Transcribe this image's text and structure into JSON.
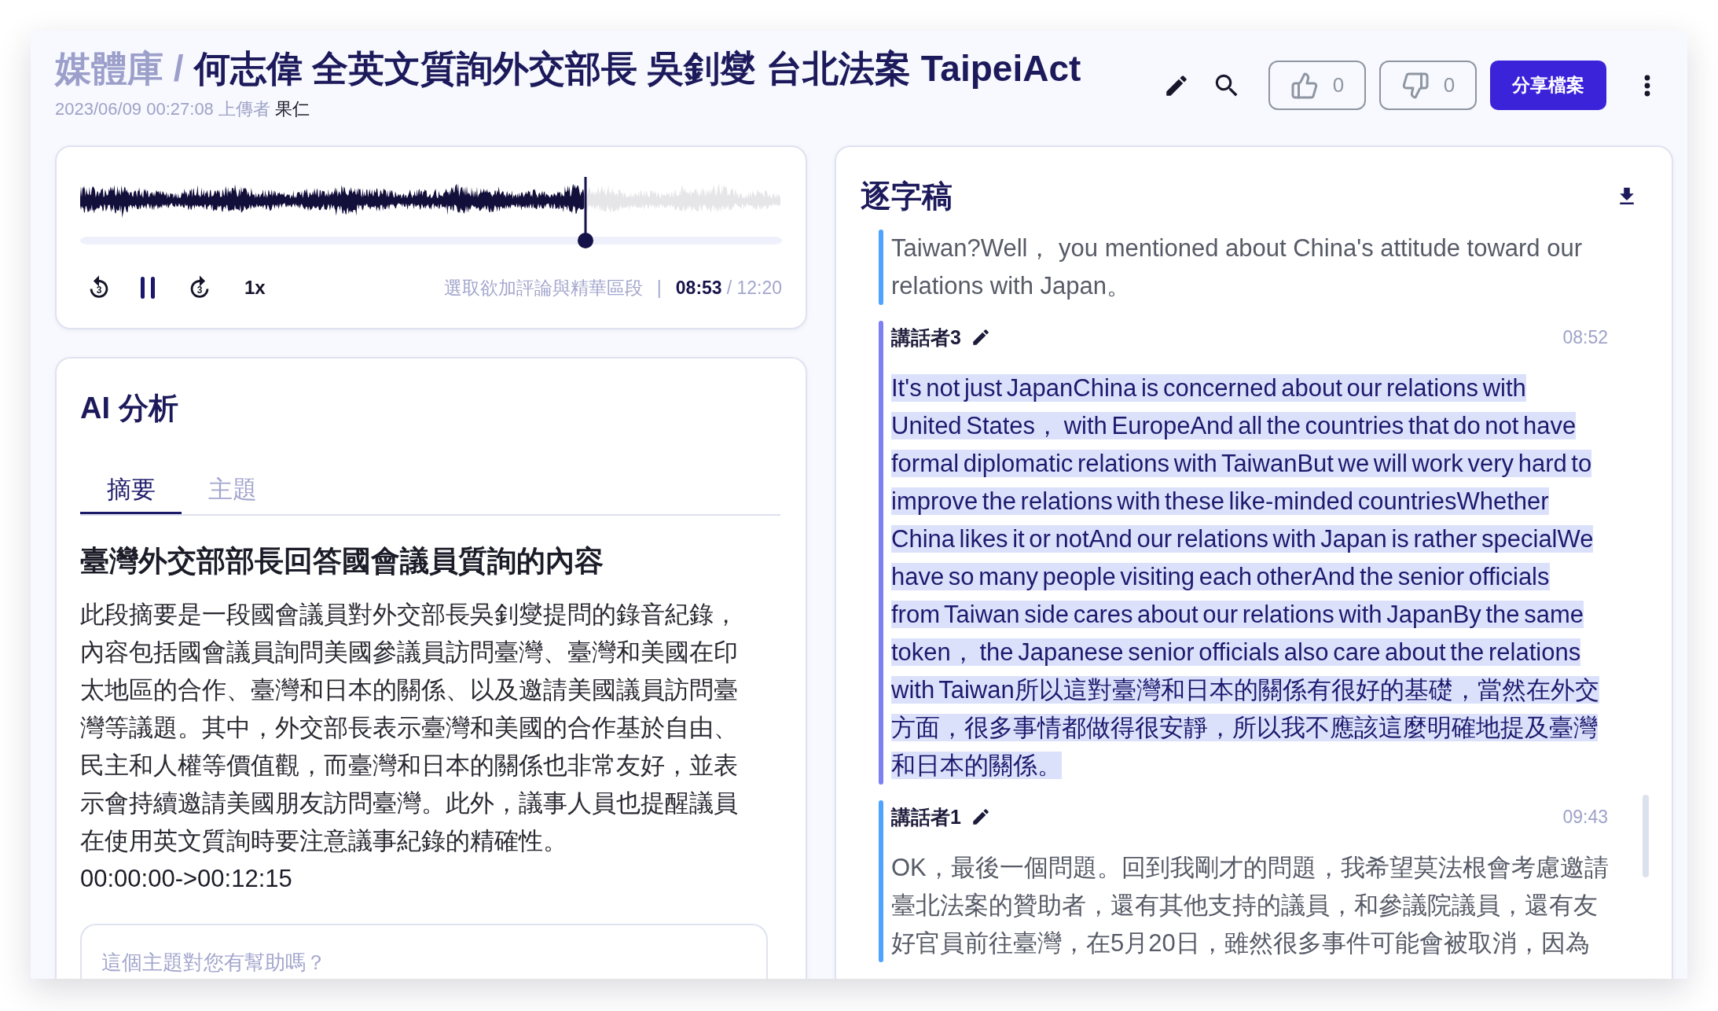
{
  "header": {
    "breadcrumb": "媒體庫 /",
    "title": "何志偉 全英文質詢外交部長 吳釗燮 台北法案 TaipeiAct",
    "upload_info": "2023/06/09 00:27:08 上傳者",
    "uploader": "果仁"
  },
  "actions": {
    "likes": "0",
    "dislikes": "0",
    "share": "分享檔案"
  },
  "player": {
    "level": 0.72,
    "playing": true,
    "rewind_label": "3",
    "forward_label": "3",
    "speed": "1x",
    "hint": "選取欲加評論與精華區段",
    "separator": "|",
    "current_time": "08:53",
    "total_time": "/ 12:20"
  },
  "ai_analysis": {
    "title": "AI 分析",
    "tabs": [
      {
        "label": "摘要",
        "selected": true
      },
      {
        "label": "主題",
        "selected": false
      }
    ],
    "heading": "臺灣外交部部長回答國會議員質詢的內容",
    "summary": "此段摘要是一段國會議員對外交部長吳釗燮提問的錄音紀錄，內容包括國會議員詢問美國參議員訪問臺灣、臺灣和美國在印太地區的合作、臺灣和日本的關係、以及邀請美國議員訪問臺灣等議題。其中，外交部長表示臺灣和美國的合作基於自由、民主和人權等價值觀，而臺灣和日本的關係也非常友好，並表示會持續邀請美國朋友訪問臺灣。此外，議事人員也提醒議員在使用英文質詢時要注意議事紀錄的精確性。",
    "time_range": "00:00:00->00:12:15",
    "feedback_prompt": "這個主題對您有幫助嗎？"
  },
  "transcript": {
    "title": "逐字稿",
    "segments": [
      {
        "active": false,
        "text": "Taiwan?Well， you mentioned about China's attitude toward our relations with Japan。"
      },
      {
        "speaker": "講話者3",
        "time": "08:52",
        "active": true,
        "text": "It's not just JapanChina is concerned about our relations with United States， with EuropeAnd all the countries that do not have formal diplomatic relations with TaiwanBut we will work very hard to improve the relations with these like-minded countriesWhether China likes it or notAnd our relations with Japan is rather specialWe have so many people visiting each otherAnd the senior officials from Taiwan side cares about our relations with JapanBy the same token， the Japanese senior officials also care about the relations with Taiwan所以這對臺灣和日本的關係有很好的基礎，當然在外交方面，很多事情都做得很安靜，所以我不應該這麼明確地提及臺灣和日本的關係。"
      },
      {
        "speaker": "講話者1",
        "time": "09:43",
        "active": false,
        "text": "OK，最後一個問題。回到我剛才的問題，我希望莫法根會考慮邀請臺北法案的贊助者，還有其他支持的議員，和參議院議員，還有友好官員前往臺灣，在5月20日，雖然很多事件可能會被取消，因為"
      }
    ]
  }
}
